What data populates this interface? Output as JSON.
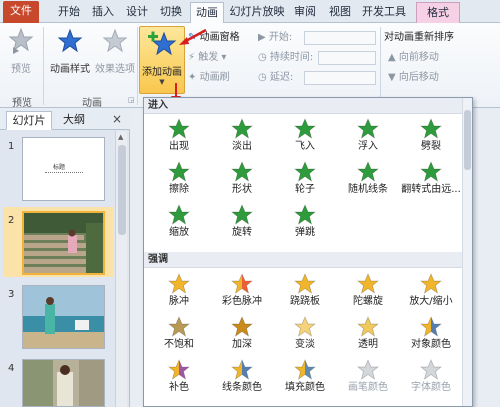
{
  "tabs": [
    "文件",
    "开始",
    "插入",
    "设计",
    "切换",
    "动画",
    "幻灯片放映",
    "审阅",
    "视图",
    "开发工具",
    "格式"
  ],
  "ribbon": {
    "preview": {
      "label": "预览",
      "group": "预览"
    },
    "anim_style": "动画样式",
    "effect_options": "效果选项",
    "anim_group": "动画",
    "add_anim": "添加动画",
    "anim_pane": "动画窗格",
    "trigger": "触发",
    "anim_painter": "动画刷",
    "start": "开始:",
    "duration": "持续时间:",
    "delay": "延迟:",
    "reorder_title": "对动画重新排序",
    "move_earlier": "向前移动",
    "move_later": "向后移动"
  },
  "slide_pane": {
    "tab_slides": "幻灯片",
    "tab_outline": "大纲",
    "close": "×",
    "slides": [
      {
        "num": "1",
        "title_text": "标题"
      },
      {
        "num": "2"
      },
      {
        "num": "3"
      },
      {
        "num": "4"
      }
    ]
  },
  "gallery": {
    "sections": [
      {
        "title": "进入",
        "items": [
          {
            "label": "出现",
            "icon": "star-appear-icon"
          },
          {
            "label": "淡出",
            "icon": "star-fade-icon"
          },
          {
            "label": "飞入",
            "icon": "star-fly-icon"
          },
          {
            "label": "浮入",
            "icon": "star-float-icon"
          },
          {
            "label": "劈裂",
            "icon": "star-split-icon"
          },
          {
            "label": "擦除",
            "icon": "star-wipe-icon"
          },
          {
            "label": "形状",
            "icon": "star-shape-icon"
          },
          {
            "label": "轮子",
            "icon": "star-wheel-icon"
          },
          {
            "label": "随机线条",
            "icon": "star-random-bars-icon"
          },
          {
            "label": "翻转式由远...",
            "icon": "star-grow-turn-icon"
          },
          {
            "label": "缩放",
            "icon": "star-zoom-icon"
          },
          {
            "label": "旋转",
            "icon": "star-swivel-icon"
          },
          {
            "label": "弹跳",
            "icon": "star-bounce-icon"
          }
        ]
      },
      {
        "title": "强调",
        "items": [
          {
            "label": "脉冲",
            "icon": "star-pulse-icon"
          },
          {
            "label": "彩色脉冲",
            "icon": "star-color-pulse-icon"
          },
          {
            "label": "跷跷板",
            "icon": "star-teeter-icon"
          },
          {
            "label": "陀螺旋",
            "icon": "star-spin-icon"
          },
          {
            "label": "放大/缩小",
            "icon": "star-grow-shrink-icon"
          },
          {
            "label": "不饱和",
            "icon": "star-desaturate-icon"
          },
          {
            "label": "加深",
            "icon": "star-darken-icon"
          },
          {
            "label": "变淡",
            "icon": "star-lighten-icon"
          },
          {
            "label": "透明",
            "icon": "star-transparency-icon"
          },
          {
            "label": "对象颜色",
            "icon": "star-object-color-icon"
          },
          {
            "label": "补色",
            "icon": "star-complementary-icon"
          },
          {
            "label": "线条颜色",
            "icon": "star-line-color-icon"
          },
          {
            "label": "填充颜色",
            "icon": "star-fill-color-icon"
          },
          {
            "label": "画笔颜色",
            "icon": "star-brush-color-icon"
          },
          {
            "label": "字体颜色",
            "icon": "star-font-color-icon"
          }
        ]
      }
    ]
  },
  "colors": {
    "file_tab": "#c8482b",
    "enter_green": "#2e9b3c",
    "emphasis_gold": "#f0b52b",
    "add_anim_highlight": "#f9c74e",
    "arrow_red": "#d81e1e"
  }
}
